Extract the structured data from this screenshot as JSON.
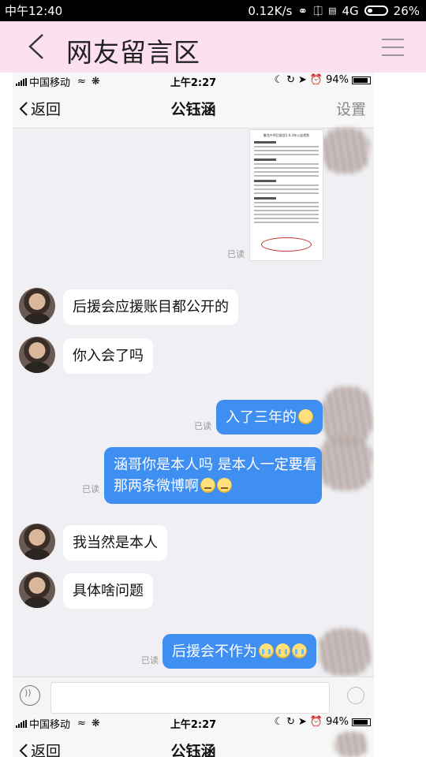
{
  "status_bar": {
    "time": "中午12:40",
    "speed": "0.12K/s",
    "network": "4G",
    "battery": "26%"
  },
  "app_header": {
    "title": "网友留言区"
  },
  "ios_status_1": {
    "carrier": "中国移动",
    "time": "上午2:27",
    "battery": "94%"
  },
  "ios_status_2": {
    "carrier": "中国移动",
    "time": "上午2:27",
    "battery": "94%"
  },
  "chat_nav_1": {
    "back_label": "返回",
    "title": "公钰涵",
    "settings_label": "设置"
  },
  "chat_nav_2": {
    "back_label": "返回",
    "title": "公钰涵"
  },
  "read_label": "已读",
  "document_image": {
    "title": "御龙乡师后援会2.0.3年公益规划"
  },
  "messages": [
    {
      "side": "in",
      "text": "后援会应援账目都公开的"
    },
    {
      "side": "in",
      "text": "你入会了吗"
    },
    {
      "side": "out",
      "text": "入了三年的"
    },
    {
      "side": "out",
      "line1": "涵哥你是本人吗 是本人一定要看",
      "line2": "那两条微博啊"
    },
    {
      "side": "in",
      "text": "我当然是本人"
    },
    {
      "side": "in",
      "text": "具体啥问题"
    },
    {
      "side": "out",
      "text": "后援会不作为"
    }
  ]
}
